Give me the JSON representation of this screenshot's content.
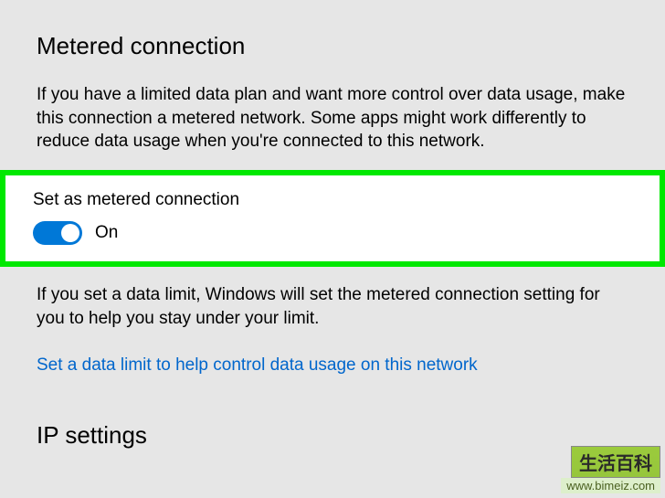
{
  "metered": {
    "heading": "Metered connection",
    "description": "If you have a limited data plan and want more control over data usage, make this connection a metered network. Some apps might work differently to reduce data usage when you're connected to this network.",
    "toggle_label": "Set as metered connection",
    "toggle_state": "On",
    "postnote": "If you set a data limit, Windows will set the metered connection setting for you to help you stay under your limit.",
    "link": "Set a data limit to help control data usage on this network"
  },
  "ip": {
    "heading": "IP settings"
  },
  "watermark": {
    "logo": "生活百科",
    "url": "www.bimeiz.com"
  }
}
